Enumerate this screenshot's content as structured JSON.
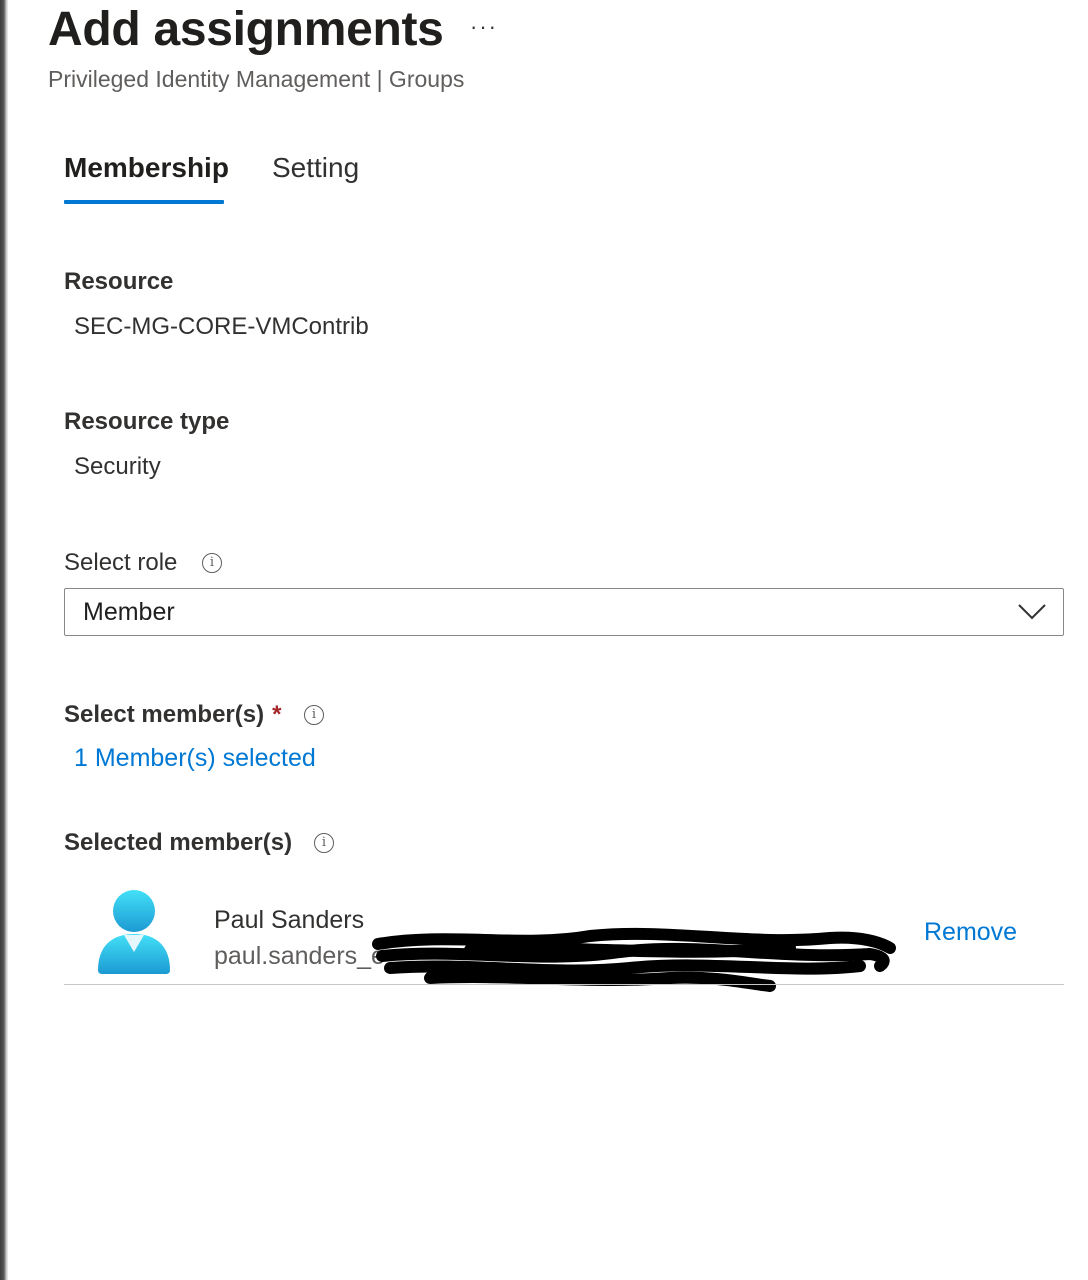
{
  "header": {
    "title": "Add assignments",
    "more_label": "···",
    "subtitle": "Privileged Identity Management | Groups"
  },
  "tabs": [
    {
      "label": "Membership",
      "active": true
    },
    {
      "label": "Setting",
      "active": false
    }
  ],
  "resource": {
    "label": "Resource",
    "value": "SEC-MG-CORE-VMContrib"
  },
  "resource_type": {
    "label": "Resource type",
    "value": "Security"
  },
  "role": {
    "label": "Select role",
    "selected": "Member"
  },
  "members": {
    "label": "Select member(s)",
    "required_mark": "*",
    "link": "1 Member(s) selected"
  },
  "selected_members": {
    "label": "Selected member(s)",
    "items": [
      {
        "name": "Paul Sanders",
        "email": "paul.sanders_e",
        "remove_label": "Remove"
      }
    ]
  },
  "icons": {
    "info": "info-icon",
    "chevron": "chevron-down-icon",
    "avatar": "user-avatar-icon"
  },
  "colors": {
    "accent": "#0078d4",
    "required": "#a4262c",
    "text": "#323130"
  }
}
